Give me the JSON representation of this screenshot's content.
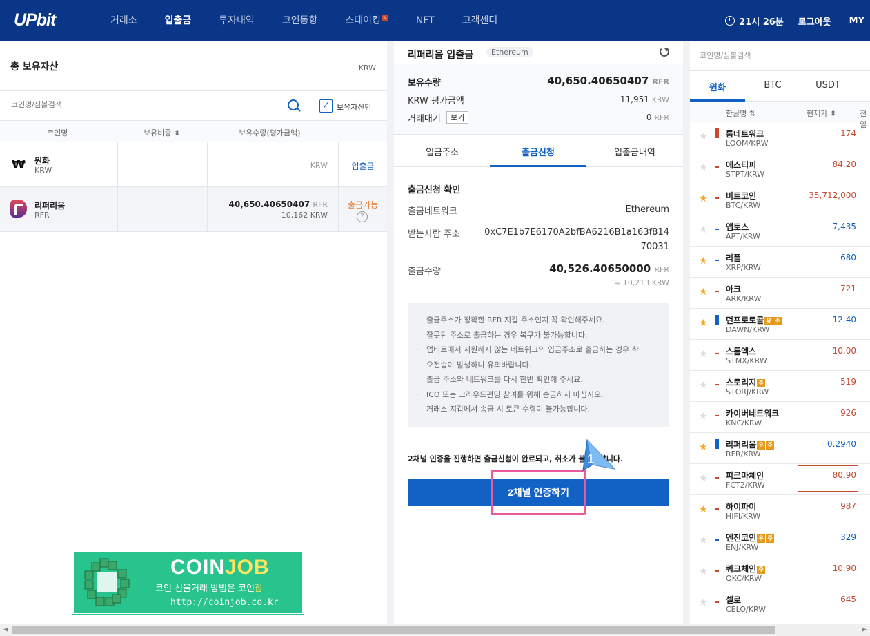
{
  "header": {
    "logo": "UPbit",
    "nav": [
      {
        "label": "거래소",
        "active": false
      },
      {
        "label": "입출금",
        "active": true
      },
      {
        "label": "투자내역",
        "active": false
      },
      {
        "label": "코인동향",
        "active": false
      },
      {
        "label": "스테이킹",
        "active": false,
        "badge": "N"
      },
      {
        "label": "NFT",
        "active": false
      },
      {
        "label": "고객센터",
        "active": false
      }
    ],
    "time": "21시 26분",
    "logout": "로그아웃",
    "my": "MY"
  },
  "left": {
    "title": "총 보유자산",
    "currency": "KRW",
    "search_placeholder": "코인명/심볼검색",
    "held_only_label": "보유자산만",
    "held_only_checked": true,
    "columns": [
      "코인명",
      "보유비중 ⬍",
      "보유수량(평가금액)"
    ],
    "rows": [
      {
        "name": "원화",
        "code": "KRW",
        "amount": "",
        "unit": "KRW",
        "sub": "",
        "action": "입출금",
        "action_color": "#1261c4"
      },
      {
        "name": "리퍼리움",
        "code": "RFR",
        "amount": "40,650.40650407",
        "unit": "RFR",
        "sub": "10,162 KRW",
        "action": "출금가능",
        "action_color": "#e57d38"
      }
    ],
    "won_symbol": "₩"
  },
  "banner": {
    "title_a": "COIN",
    "title_b": "JOB",
    "subtitle_a": "코인 선물거래 방법은 코인",
    "subtitle_b": "잡",
    "url": "http://coinjob.co.kr"
  },
  "middle": {
    "title": "리퍼리움 입출금",
    "network_tag": "Ethereum",
    "holdings": {
      "label": "보유수량",
      "value": "40,650.40650407",
      "unit": "RFR",
      "krw_label": "KRW 평가금액",
      "krw_value": "11,951",
      "krw_unit": "KRW",
      "pending_label": "거래대기",
      "pending_button": "보기",
      "pending_value": "0",
      "pending_unit": "RFR"
    },
    "tabs": [
      "입금주소",
      "출금신청",
      "입출금내역"
    ],
    "active_tab": 1,
    "confirm_title": "출금신청 확인",
    "network_label": "출금네트워크",
    "network_value": "Ethereum",
    "address_label": "받는사람 주소",
    "address_line1": "0xC7E1b7E6170A2bfBA6216B1a163f814",
    "address_line2": "70031",
    "amount_label": "출금수량",
    "amount_value": "40,526.40650000",
    "amount_unit": "RFR",
    "amount_krw": "≈ 10,213 KRW",
    "notice": [
      "출금주소가 정확한 RFR 지갑 주소인지 꼭 확인해주세요.",
      "잘못된 주소로 출금하는 경우 복구가 불가능합니다.",
      "업비트에서 지원하지 않는 네트워크의 입금주소로 출금하는 경우 착",
      "오전송이 발생하니 유의바랍니다.",
      "출금 주소와 네트워크를 다시 한번 확인해 주세요.",
      "ICO 또는 크라우드펀딩 참여를 위해 송금하지 마십시오.",
      "거래소 지갑에서 송금 시 토큰 수령이 불가능합니다."
    ],
    "bullet": "·",
    "confirm_text": "2채널 인증을 진행하면 출금신청이 완료되고, 취소가 불가능합니다.",
    "auth_button": "2채널 인증하기",
    "step_number": "1"
  },
  "right": {
    "search_placeholder": "코인명/심볼검색",
    "tabs": [
      "원화",
      "BTC",
      "USDT"
    ],
    "columns": [
      "한글명 ⇅",
      "현재가 ⬍",
      "전일"
    ],
    "coins": [
      {
        "name": "룸네트워크",
        "code": "LOOM/KRW",
        "price": "174",
        "dir": "up",
        "star": false,
        "badges": [],
        "big": true
      },
      {
        "name": "에스티피",
        "code": "STPT/KRW",
        "price": "84.20",
        "dir": "up",
        "star": false,
        "badges": [],
        "big": false
      },
      {
        "name": "비트코인",
        "code": "BTC/KRW",
        "price": "35,712,000",
        "dir": "up",
        "star": true,
        "badges": [],
        "big": false
      },
      {
        "name": "앱토스",
        "code": "APT/KRW",
        "price": "7,435",
        "dir": "dn",
        "star": false,
        "badges": [],
        "big": false
      },
      {
        "name": "리플",
        "code": "XRP/KRW",
        "price": "680",
        "dir": "dn",
        "star": true,
        "badges": [],
        "big": false
      },
      {
        "name": "아크",
        "code": "ARK/KRW",
        "price": "721",
        "dir": "up",
        "star": true,
        "badges": [],
        "big": false
      },
      {
        "name": "던프로토콜",
        "code": "DAWN/KRW",
        "price": "12.40",
        "dir": "dn",
        "star": true,
        "badges": [
          "유",
          "주"
        ],
        "big": true
      },
      {
        "name": "스톰엑스",
        "code": "STMX/KRW",
        "price": "10.00",
        "dir": "up",
        "star": false,
        "badges": [],
        "big": false
      },
      {
        "name": "스토리지",
        "code": "STORJ/KRW",
        "price": "519",
        "dir": "up",
        "star": false,
        "badges": [
          "주"
        ],
        "big": false
      },
      {
        "name": "카이버네트워크",
        "code": "KNC/KRW",
        "price": "926",
        "dir": "up",
        "star": false,
        "badges": [],
        "big": false
      },
      {
        "name": "리퍼리움",
        "code": "RFR/KRW",
        "price": "0.2940",
        "dir": "dn",
        "star": true,
        "badges": [
          "유",
          "주"
        ],
        "big": true
      },
      {
        "name": "피르마체인",
        "code": "FCT2/KRW",
        "price": "80.90",
        "dir": "up",
        "star": false,
        "badges": [],
        "big": false,
        "selected": true
      },
      {
        "name": "하이파이",
        "code": "HIFI/KRW",
        "price": "987",
        "dir": "up",
        "star": true,
        "badges": [],
        "big": false
      },
      {
        "name": "엔진코인",
        "code": "ENJ/KRW",
        "price": "329",
        "dir": "dn",
        "star": false,
        "badges": [
          "유",
          "주"
        ],
        "big": false
      },
      {
        "name": "쿼크체인",
        "code": "QKC/KRW",
        "price": "10.90",
        "dir": "up",
        "star": false,
        "badges": [
          "주"
        ],
        "big": false
      },
      {
        "name": "셀로",
        "code": "CELO/KRW",
        "price": "645",
        "dir": "up",
        "star": false,
        "badges": [],
        "big": false
      }
    ]
  }
}
